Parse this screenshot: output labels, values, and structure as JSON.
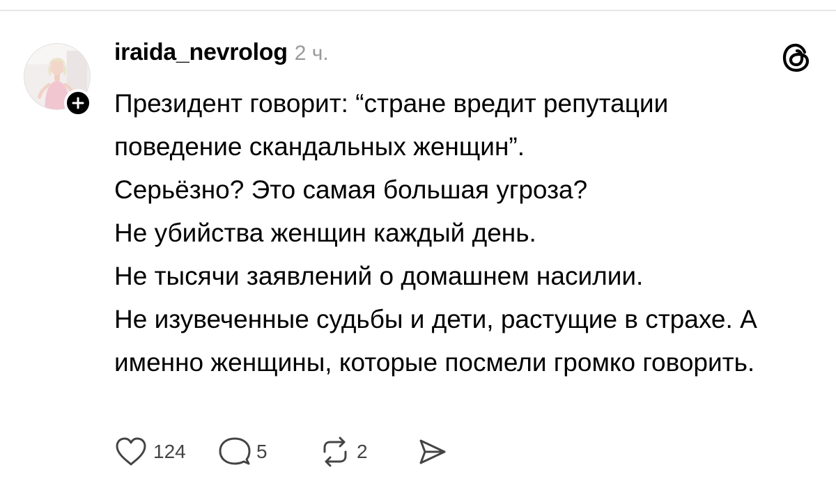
{
  "post": {
    "username": "iraida_nevrolog",
    "timestamp": "2 ч.",
    "paragraphs": [
      "Президент говорит: “стране вредит репутации поведение скандальных женщин”.",
      "Серьёзно? Это самая большая угроза?",
      "Не убийства женщин каждый день.",
      "Не тысячи заявлений о домашнем насилии.",
      "Не изувеченные судьбы и дети, растущие в страхе. А именно женщины, которые посмели громко говорить."
    ],
    "actions": {
      "like_count": "124",
      "reply_count": "5",
      "repost_count": "2"
    }
  },
  "icons": {
    "avatar": "user-avatar",
    "follow": "plus-icon",
    "brand": "threads-logo-icon",
    "like": "heart-icon",
    "reply": "comment-icon",
    "repost": "repost-icon",
    "share": "send-icon"
  },
  "colors": {
    "text": "#000000",
    "muted": "#999999",
    "icon": "#444444",
    "divider": "#e6e6e6"
  }
}
